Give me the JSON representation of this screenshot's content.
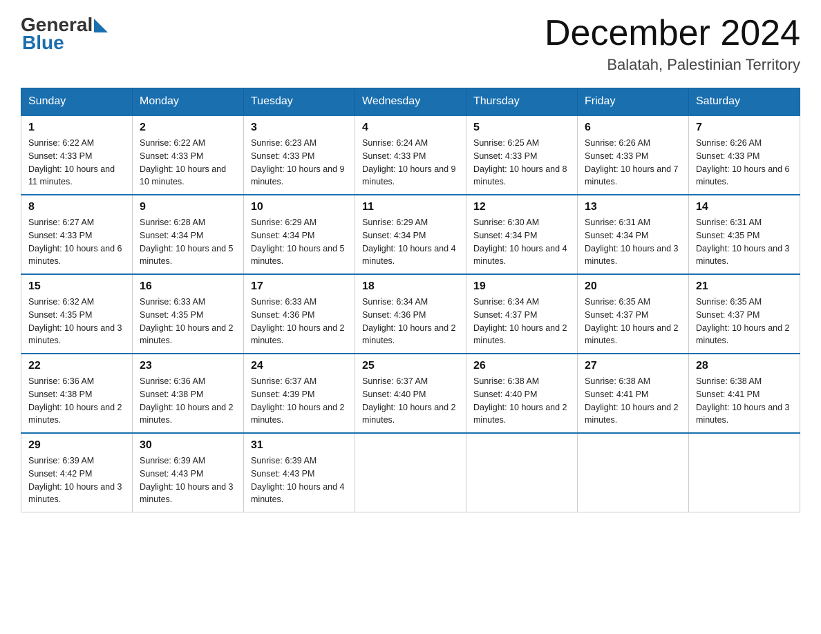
{
  "logo": {
    "general": "General",
    "blue": "Blue"
  },
  "title": "December 2024",
  "subtitle": "Balatah, Palestinian Territory",
  "days_of_week": [
    "Sunday",
    "Monday",
    "Tuesday",
    "Wednesday",
    "Thursday",
    "Friday",
    "Saturday"
  ],
  "weeks": [
    [
      {
        "day": "1",
        "sunrise": "6:22 AM",
        "sunset": "4:33 PM",
        "daylight": "10 hours and 11 minutes."
      },
      {
        "day": "2",
        "sunrise": "6:22 AM",
        "sunset": "4:33 PM",
        "daylight": "10 hours and 10 minutes."
      },
      {
        "day": "3",
        "sunrise": "6:23 AM",
        "sunset": "4:33 PM",
        "daylight": "10 hours and 9 minutes."
      },
      {
        "day": "4",
        "sunrise": "6:24 AM",
        "sunset": "4:33 PM",
        "daylight": "10 hours and 9 minutes."
      },
      {
        "day": "5",
        "sunrise": "6:25 AM",
        "sunset": "4:33 PM",
        "daylight": "10 hours and 8 minutes."
      },
      {
        "day": "6",
        "sunrise": "6:26 AM",
        "sunset": "4:33 PM",
        "daylight": "10 hours and 7 minutes."
      },
      {
        "day": "7",
        "sunrise": "6:26 AM",
        "sunset": "4:33 PM",
        "daylight": "10 hours and 6 minutes."
      }
    ],
    [
      {
        "day": "8",
        "sunrise": "6:27 AM",
        "sunset": "4:33 PM",
        "daylight": "10 hours and 6 minutes."
      },
      {
        "day": "9",
        "sunrise": "6:28 AM",
        "sunset": "4:34 PM",
        "daylight": "10 hours and 5 minutes."
      },
      {
        "day": "10",
        "sunrise": "6:29 AM",
        "sunset": "4:34 PM",
        "daylight": "10 hours and 5 minutes."
      },
      {
        "day": "11",
        "sunrise": "6:29 AM",
        "sunset": "4:34 PM",
        "daylight": "10 hours and 4 minutes."
      },
      {
        "day": "12",
        "sunrise": "6:30 AM",
        "sunset": "4:34 PM",
        "daylight": "10 hours and 4 minutes."
      },
      {
        "day": "13",
        "sunrise": "6:31 AM",
        "sunset": "4:34 PM",
        "daylight": "10 hours and 3 minutes."
      },
      {
        "day": "14",
        "sunrise": "6:31 AM",
        "sunset": "4:35 PM",
        "daylight": "10 hours and 3 minutes."
      }
    ],
    [
      {
        "day": "15",
        "sunrise": "6:32 AM",
        "sunset": "4:35 PM",
        "daylight": "10 hours and 3 minutes."
      },
      {
        "day": "16",
        "sunrise": "6:33 AM",
        "sunset": "4:35 PM",
        "daylight": "10 hours and 2 minutes."
      },
      {
        "day": "17",
        "sunrise": "6:33 AM",
        "sunset": "4:36 PM",
        "daylight": "10 hours and 2 minutes."
      },
      {
        "day": "18",
        "sunrise": "6:34 AM",
        "sunset": "4:36 PM",
        "daylight": "10 hours and 2 minutes."
      },
      {
        "day": "19",
        "sunrise": "6:34 AM",
        "sunset": "4:37 PM",
        "daylight": "10 hours and 2 minutes."
      },
      {
        "day": "20",
        "sunrise": "6:35 AM",
        "sunset": "4:37 PM",
        "daylight": "10 hours and 2 minutes."
      },
      {
        "day": "21",
        "sunrise": "6:35 AM",
        "sunset": "4:37 PM",
        "daylight": "10 hours and 2 minutes."
      }
    ],
    [
      {
        "day": "22",
        "sunrise": "6:36 AM",
        "sunset": "4:38 PM",
        "daylight": "10 hours and 2 minutes."
      },
      {
        "day": "23",
        "sunrise": "6:36 AM",
        "sunset": "4:38 PM",
        "daylight": "10 hours and 2 minutes."
      },
      {
        "day": "24",
        "sunrise": "6:37 AM",
        "sunset": "4:39 PM",
        "daylight": "10 hours and 2 minutes."
      },
      {
        "day": "25",
        "sunrise": "6:37 AM",
        "sunset": "4:40 PM",
        "daylight": "10 hours and 2 minutes."
      },
      {
        "day": "26",
        "sunrise": "6:38 AM",
        "sunset": "4:40 PM",
        "daylight": "10 hours and 2 minutes."
      },
      {
        "day": "27",
        "sunrise": "6:38 AM",
        "sunset": "4:41 PM",
        "daylight": "10 hours and 2 minutes."
      },
      {
        "day": "28",
        "sunrise": "6:38 AM",
        "sunset": "4:41 PM",
        "daylight": "10 hours and 3 minutes."
      }
    ],
    [
      {
        "day": "29",
        "sunrise": "6:39 AM",
        "sunset": "4:42 PM",
        "daylight": "10 hours and 3 minutes."
      },
      {
        "day": "30",
        "sunrise": "6:39 AM",
        "sunset": "4:43 PM",
        "daylight": "10 hours and 3 minutes."
      },
      {
        "day": "31",
        "sunrise": "6:39 AM",
        "sunset": "4:43 PM",
        "daylight": "10 hours and 4 minutes."
      },
      null,
      null,
      null,
      null
    ]
  ]
}
